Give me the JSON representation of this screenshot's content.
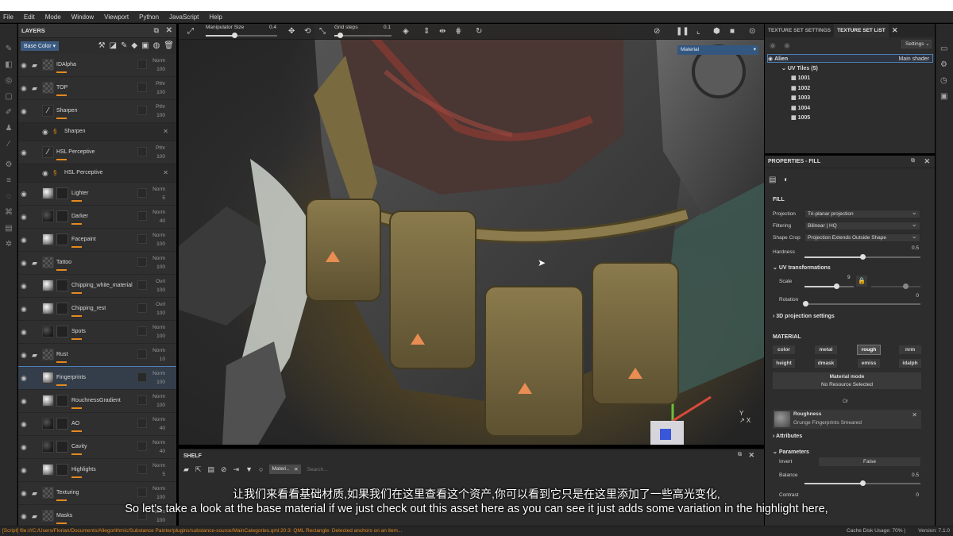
{
  "menu": [
    "File",
    "Edit",
    "Mode",
    "Window",
    "Viewport",
    "Python",
    "JavaScript",
    "Help"
  ],
  "layers_panel": {
    "title": "LAYERS",
    "channel": "Base Color",
    "items": [
      {
        "name": "IDAlpha",
        "blend": "Norm",
        "opacity": "100",
        "type": "folder"
      },
      {
        "name": "TOP",
        "blend": "Pthr",
        "opacity": "100",
        "type": "folder"
      },
      {
        "name": "Sharpen",
        "blend": "Pthr",
        "opacity": "100",
        "type": "filter"
      },
      {
        "name": "Sharpen",
        "type": "effect"
      },
      {
        "name": "HSL Perceptive",
        "blend": "Pthr",
        "opacity": "100",
        "type": "filter"
      },
      {
        "name": "HSL Perceptive",
        "type": "effect"
      },
      {
        "name": "Lighter",
        "blend": "Norm",
        "opacity": "5",
        "type": "fill"
      },
      {
        "name": "Darker",
        "blend": "Norm",
        "opacity": "40",
        "type": "fill"
      },
      {
        "name": "Facepaint",
        "blend": "Norm",
        "opacity": "100",
        "type": "fill"
      },
      {
        "name": "Tattoo",
        "blend": "Norm",
        "opacity": "100",
        "type": "folder"
      },
      {
        "name": "Chipping_white_material",
        "blend": "Ovrl",
        "opacity": "100",
        "type": "fill"
      },
      {
        "name": "Chipping_rest",
        "blend": "Ovrl",
        "opacity": "100",
        "type": "fill"
      },
      {
        "name": "Spots",
        "blend": "Norm",
        "opacity": "100",
        "type": "fill"
      },
      {
        "name": "Rust",
        "blend": "Norm",
        "opacity": "10",
        "type": "folder"
      },
      {
        "name": "Fingerprints",
        "blend": "Norm",
        "opacity": "100",
        "type": "fill",
        "selected": true
      },
      {
        "name": "RouchnessGradient",
        "blend": "Norm",
        "opacity": "100",
        "type": "fill"
      },
      {
        "name": "AO",
        "blend": "Norm",
        "opacity": "40",
        "type": "fill"
      },
      {
        "name": "Cavity",
        "blend": "Norm",
        "opacity": "40",
        "type": "fill"
      },
      {
        "name": "Highlights",
        "blend": "Norm",
        "opacity": "5",
        "type": "fill"
      },
      {
        "name": "Texturing",
        "blend": "Norm",
        "opacity": "100",
        "type": "folder"
      },
      {
        "name": "Masks",
        "blend": "Norm",
        "opacity": "100",
        "type": "folder"
      }
    ]
  },
  "viewport": {
    "manipulator_label": "Manipulator Size",
    "manipulator_value": "0.4",
    "manipulator_level": 0.4,
    "grid_label": "Grid steps",
    "grid_value": "0.1",
    "grid_level": 0.1,
    "channel_dropdown": "Material"
  },
  "shelf": {
    "title": "SHELF",
    "filter_tag": "Materi..",
    "search_placeholder": "Search..."
  },
  "texture_set": {
    "tab_settings": "TEXTURE SET SETTINGS",
    "tab_list": "TEXTURE SET LIST",
    "settings_button": "Settings",
    "set_name": "Alien",
    "shader": "Main shader",
    "uv_tiles_label": "UV Tiles (5)",
    "tiles": [
      "1001",
      "1002",
      "1003",
      "1004",
      "1005"
    ]
  },
  "properties": {
    "title": "PROPERTIES - FILL",
    "fill_section": "FILL",
    "projection_label": "Projection",
    "projection_value": "Tri-planar projection",
    "filtering_label": "Filtering",
    "filtering_value": "Bilinear | HQ",
    "shape_crop_label": "Shape Crop",
    "shape_crop_value": "Projection Extends Outside Shape",
    "hardness_label": "Hardness",
    "hardness_value": "0.5",
    "hardness_level": 0.5,
    "uv_transform_label": "UV transformations",
    "scale_label": "Scale",
    "scale_value": "9",
    "rotation_label": "Rotation",
    "rotation_value": "0",
    "projection3d_label": "3D projection settings",
    "material_section": "MATERIAL",
    "channels": [
      "color",
      "metal",
      "rough",
      "nrm",
      "height",
      "dmask",
      "emiss",
      "idalph"
    ],
    "active_channel": "rough",
    "material_mode_label": "Material mode",
    "material_mode_value": "No Resource Selected",
    "or_label": "Or",
    "roughness_title": "Roughness",
    "roughness_resource": "Grunge Fingerprints Smeared",
    "attributes_label": "Attributes",
    "parameters_label": "Parameters",
    "invert_label": "Invert",
    "invert_value": "False",
    "balance_label": "Balance",
    "balance_value": "0.5",
    "balance_level": 0.5,
    "contrast_label": "Contrast",
    "contrast_value": "0"
  },
  "subtitles": {
    "chinese": "让我们来看看基础材质,如果我们在这里查看这个资产,你可以看到它只是在这里添加了一些高光变化,",
    "english": "So let's take a look at the base material if we just check out this asset here as you can see it just adds some variation in the highlight here,"
  },
  "status": {
    "message": "[Script] file:///C:/Users/Florian/Documents/Allegorithmic/Substance Painter/plugins/substance-source/MainCategories.qml:20:3: QML Rectangle: Detected anchors on an item...",
    "cache": "Cache Disk Usage:",
    "cache_value": "70%",
    "version": "Version: 7.1.0"
  },
  "colors": {
    "accent": "#e48a1f",
    "selection": "#4f7fb8",
    "material_dropdown": "#34577f"
  }
}
